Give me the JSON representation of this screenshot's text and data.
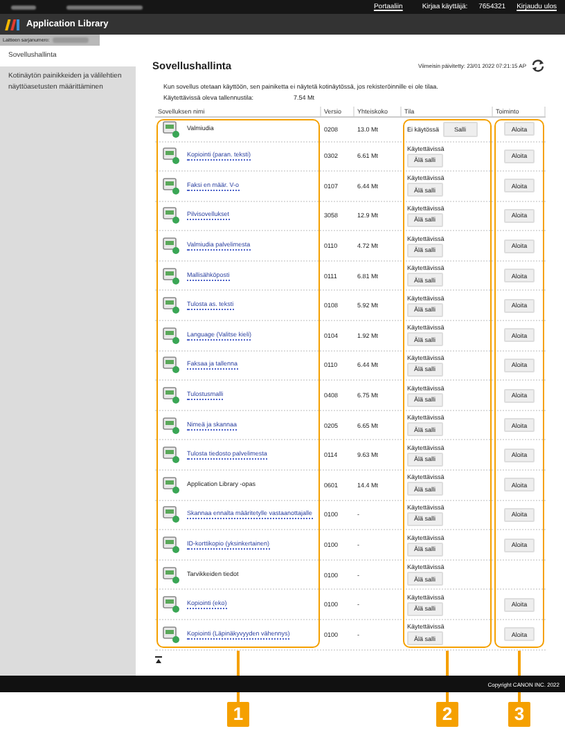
{
  "top_bar": {
    "links": [
      "Portaaliin",
      "Kirjaudu ulos"
    ],
    "user_label": "Kirjaa käyttäjä:",
    "user_id": "7654321"
  },
  "header": {
    "title": "Application Library"
  },
  "breadcrumb": {
    "label": "Laitteen sarjanumero:"
  },
  "sidebar": {
    "items": [
      {
        "label": "Sovellushallinta",
        "selected": true
      },
      {
        "label": "Kotinäytön painikkeiden ja välilehtien näyttöasetusten määrittäminen",
        "selected": false
      }
    ]
  },
  "main": {
    "title": "Sovellushallinta",
    "last_updated": "Viimeisin päivitetty: 23/01 2022 07:21:15 AP",
    "note": "Kun sovellus otetaan käyttöön, sen painiketta ei näytetä kotinäytössä, jos rekisteröinnille ei ole tilaa.",
    "storage_label": "Käytettävissä oleva tallennustila:",
    "storage_value": "7.54 Mt"
  },
  "table": {
    "columns": [
      {
        "label": "Sovelluksen nimi",
        "callout": "1"
      },
      {
        "label": "Versio"
      },
      {
        "label": "Yhteiskoko"
      },
      {
        "label": "Tila",
        "callout": "2"
      },
      {
        "label": "Toiminto",
        "callout": "3"
      }
    ],
    "rows": [
      {
        "name": "Valmiudia",
        "link": false,
        "version": "0208",
        "size": "13.0 Mt",
        "enabled": false,
        "status": "Ei käytössä",
        "status_button": "Salli",
        "action": "Aloita"
      },
      {
        "name": "Kopiointi (paran. teksti)",
        "link": true,
        "version": "0302",
        "size": "6.61 Mt",
        "enabled": true,
        "status": "Käytettävissä",
        "status_button": "Älä salli",
        "action": "Aloita"
      },
      {
        "name": "Faksi en määr. V-o",
        "link": true,
        "version": "0107",
        "size": "6.44 Mt",
        "enabled": true,
        "status": "Käytettävissä",
        "status_button": "Älä salli",
        "action": "Aloita"
      },
      {
        "name": "Pilvisovellukset",
        "link": true,
        "version": "3058",
        "size": "12.9 Mt",
        "enabled": true,
        "status": "Käytettävissä",
        "status_button": "Älä salli",
        "action": "Aloita"
      },
      {
        "name": "Valmiudia palvelimesta",
        "link": true,
        "version": "0110",
        "size": "4.72 Mt",
        "enabled": true,
        "status": "Käytettävissä",
        "status_button": "Älä salli",
        "action": "Aloita"
      },
      {
        "name": "Mallisähköposti",
        "link": true,
        "version": "0111",
        "size": "6.81 Mt",
        "enabled": true,
        "status": "Käytettävissä",
        "status_button": "Älä salli",
        "action": "Aloita"
      },
      {
        "name": "Tulosta as. teksti",
        "link": true,
        "version": "0108",
        "size": "5.92 Mt",
        "enabled": true,
        "status": "Käytettävissä",
        "status_button": "Älä salli",
        "action": "Aloita"
      },
      {
        "name": "Language (Valitse kieli)",
        "link": true,
        "version": "0104",
        "size": "1.92 Mt",
        "enabled": true,
        "status": "Käytettävissä",
        "status_button": "Älä salli",
        "action": "Aloita"
      },
      {
        "name": "Faksaa ja tallenna",
        "link": true,
        "version": "0110",
        "size": "6.44 Mt",
        "enabled": true,
        "status": "Käytettävissä",
        "status_button": "Älä salli",
        "action": "Aloita"
      },
      {
        "name": "Tulostusmalli",
        "link": true,
        "version": "0408",
        "size": "6.75 Mt",
        "enabled": true,
        "status": "Käytettävissä",
        "status_button": "Älä salli",
        "action": "Aloita"
      },
      {
        "name": "Nimeä ja skannaa",
        "link": true,
        "version": "0205",
        "size": "6.65 Mt",
        "enabled": true,
        "status": "Käytettävissä",
        "status_button": "Älä salli",
        "action": "Aloita"
      },
      {
        "name": "Tulosta tiedosto palvelimesta",
        "link": true,
        "version": "0114",
        "size": "9.63 Mt",
        "enabled": true,
        "status": "Käytettävissä",
        "status_button": "Älä salli",
        "action": "Aloita"
      },
      {
        "name": "Application Library -opas",
        "link": false,
        "version": "0601",
        "size": "14.4 Mt",
        "enabled": true,
        "status": "Käytettävissä",
        "status_button": "Älä salli",
        "action": "Aloita"
      },
      {
        "name": "Skannaa ennalta määritetylle vastaanottajalle",
        "link": true,
        "version": "0100",
        "size": "-",
        "enabled": true,
        "status": "Käytettävissä",
        "status_button": "Älä salli",
        "action": "Aloita"
      },
      {
        "name": "ID-korttikopio (yksinkertainen)",
        "link": true,
        "version": "0100",
        "size": "-",
        "enabled": true,
        "status": "Käytettävissä",
        "status_button": "Älä salli",
        "action": "Aloita"
      },
      {
        "name": "Tarvikkeiden tiedot",
        "link": false,
        "version": "0100",
        "size": "-",
        "enabled": true,
        "status": "Käytettävissä",
        "status_button": "Älä salli"
      },
      {
        "name": "Kopiointi (eko)",
        "link": true,
        "version": "0100",
        "size": "-",
        "enabled": true,
        "status": "Käytettävissä",
        "status_button": "Älä salli",
        "action": "Aloita"
      },
      {
        "name": "Kopiointi (Läpinäkyvyyden vähennys)",
        "link": true,
        "version": "0100",
        "size": "-",
        "enabled": true,
        "status": "Käytettävissä",
        "status_button": "Älä salli",
        "action": "Aloita"
      }
    ]
  },
  "footer": {
    "copyright": "Copyright CANON INC. 2022"
  }
}
